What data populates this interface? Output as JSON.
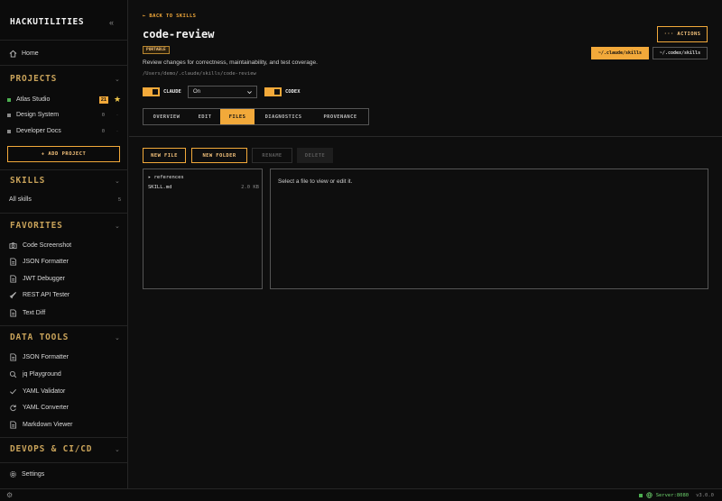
{
  "sidebar": {
    "brand": "HACKUTILITIES",
    "home_label": "Home",
    "projects_title": "PROJECTS",
    "projects": [
      {
        "name": "Atlas Studio",
        "badge": "21",
        "dot_color": "#4caf50"
      },
      {
        "name": "Design System",
        "count": "0",
        "dot_color": "#8a8a8a"
      },
      {
        "name": "Developer Docs",
        "count": "0",
        "dot_color": "#8a8a8a"
      }
    ],
    "add_project_label": "+ ADD PROJECT",
    "skills_title": "SKILLS",
    "all_skills_label": "All skills",
    "all_skills_count": "5",
    "favorites_title": "FAVORITES",
    "favorites": [
      {
        "label": "Code Screenshot",
        "icon": "camera-icon"
      },
      {
        "label": "JSON Formatter",
        "icon": "document-icon"
      },
      {
        "label": "JWT Debugger",
        "icon": "document-icon"
      },
      {
        "label": "REST API Tester",
        "icon": "rocket-icon"
      },
      {
        "label": "Text Diff",
        "icon": "document-icon"
      }
    ],
    "data_tools_title": "DATA TOOLS",
    "data_tools": [
      {
        "label": "JSON Formatter",
        "icon": "document-icon"
      },
      {
        "label": "jq Playground",
        "icon": "search-icon"
      },
      {
        "label": "YAML Validator",
        "icon": "check-icon"
      },
      {
        "label": "YAML Converter",
        "icon": "refresh-icon"
      },
      {
        "label": "Markdown Viewer",
        "icon": "document-icon"
      }
    ],
    "devops_title": "DEVOPS & CI/CD",
    "settings_label": "Settings"
  },
  "main": {
    "back_label": "← BACK TO SKILLS",
    "title": "code-review",
    "badge": "PORTABLE",
    "description": "Review changes for correctness, maintainability, and test coverage.",
    "path": "/Users/demo/.claude/skills/code-review",
    "claude_label": "CLAUDE",
    "claude_select_value": "On",
    "codex_label": "CODEX",
    "actions_label": "··· ACTIONS",
    "path_buttons": [
      "~/.claude/skills",
      "~/.codex/skills"
    ],
    "tabs": [
      "OVERVIEW",
      "EDIT",
      "FILES",
      "DIAGNOSTICS",
      "PROVENANCE"
    ],
    "active_tab": "FILES",
    "file_buttons": {
      "new_file": "NEW FILE",
      "new_folder": "NEW FOLDER",
      "rename": "RENAME",
      "delete": "DELETE"
    },
    "tree": {
      "folder": "▸ references",
      "file_name": "SKILL.md",
      "file_size": "2.0 KB"
    },
    "viewer_message": "Select a file to view or edit it."
  },
  "statusbar": {
    "server": "Server:8080",
    "version": "v3.0.0"
  },
  "colors": {
    "accent": "#f2a93a",
    "section_title": "#c9a35a",
    "server_ok": "#4caf50",
    "background": "#0e0e0e"
  }
}
